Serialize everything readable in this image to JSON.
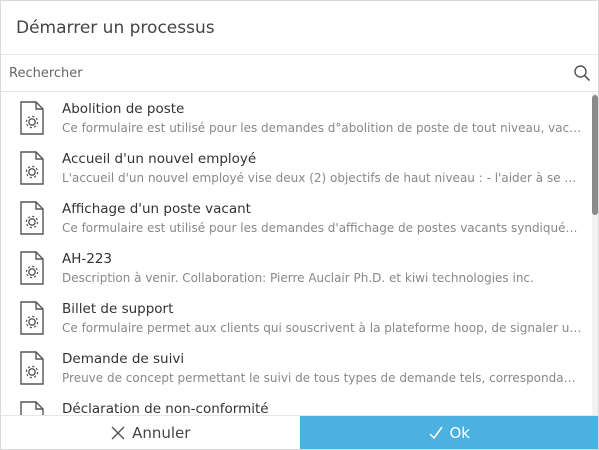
{
  "dialog": {
    "title": "Démarrer un processus"
  },
  "search": {
    "placeholder": "Rechercher"
  },
  "processes": [
    {
      "title": "Abolition de poste",
      "description": "Ce formulaire est utilisé pour les demandes d°abolition de poste de tout niveau, vacant ou occupé."
    },
    {
      "title": "Accueil d'un nouvel employé",
      "description": "L'accueil d'un nouvel employé vise deux (2) objectifs de haut niveau : - l'aider à se sentir le bienvenu"
    },
    {
      "title": "Affichage d'un poste vacant",
      "description": "Ce formulaire est utilisé pour les demandes d'affichage de postes vacants syndiqués (catégories)"
    },
    {
      "title": "AH-223",
      "description": "Description à venir. Collaboration: Pierre Auclair Ph.D. et kiwi technologies inc."
    },
    {
      "title": "Billet de support",
      "description": "Ce formulaire permet aux clients qui souscrivent à la plateforme hoop, de signaler un problème"
    },
    {
      "title": "Demande de suivi",
      "description": "Preuve de concept permettant le suivi de tous types de demande tels, correspondance, plaintes"
    },
    {
      "title": "Déclaration de non-conformité",
      "description": ""
    }
  ],
  "footer": {
    "cancel_label": "Annuler",
    "ok_label": "Ok"
  },
  "colors": {
    "accent": "#4cb1e1",
    "icon": "#555555"
  }
}
